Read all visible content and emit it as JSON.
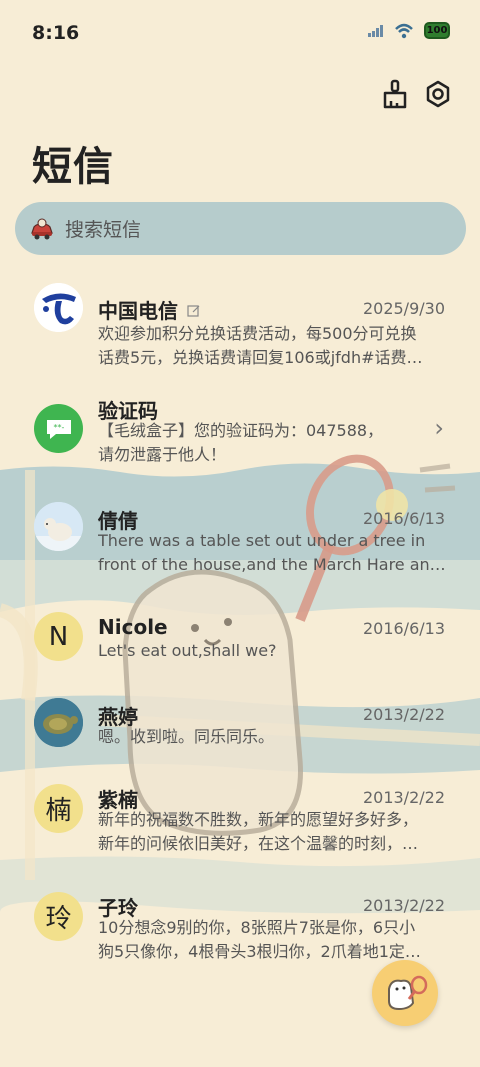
{
  "status_bar": {
    "time": "8:16",
    "battery": "100"
  },
  "header": {
    "title": "短信"
  },
  "search": {
    "placeholder": "搜索短信"
  },
  "messages": [
    {
      "sender": "中国电信",
      "date": "2025/9/30",
      "line1": "欢迎参加积分兑换话费活动，每500分可兑换",
      "line2": "话费5元，兑换话费请回复106或jfdh#话费…",
      "avatar": "china-telecom-logo"
    },
    {
      "sender": "验证码",
      "date": "",
      "line1": "【毛绒盒子】您的验证码为：047588，",
      "line2": "请勿泄露于他人！",
      "avatar": "message-bubble-icon"
    },
    {
      "sender": "倩倩",
      "date": "2016/6/13",
      "line1": "There was a table set out under a tree in",
      "line2": "front of the house,and the March Hare an…",
      "avatar": "polar-bear-photo"
    },
    {
      "sender": "Nicole",
      "date": "2016/6/13",
      "line1": "Let's eat out,shall we?",
      "line2": "",
      "avatar_letter": "N"
    },
    {
      "sender": "燕婷",
      "date": "2013/2/22",
      "line1": "嗯。收到啦。同乐同乐。",
      "line2": "",
      "avatar": "sea-turtle-photo"
    },
    {
      "sender": "紫楠",
      "date": "2013/2/22",
      "line1": "新年的祝福数不胜数，新年的愿望好多好多，",
      "line2": "新年的问候依旧美好，在这个温馨的时刻，…",
      "avatar_letter": "楠"
    },
    {
      "sender": "子玲",
      "date": "2013/2/22",
      "line1": "10分想念9别的你，8张照片7张是你，6只小",
      "line2": "狗5只像你，4根骨头3根归你，2爪着地1定…",
      "avatar_letter": "玲"
    }
  ],
  "colors": {
    "background": "#f7edd6",
    "search_bg": "#b6cccc",
    "letter_avatar": "#f2e08c",
    "fab": "#f7ce73",
    "stripe": "#b9cfcf"
  }
}
